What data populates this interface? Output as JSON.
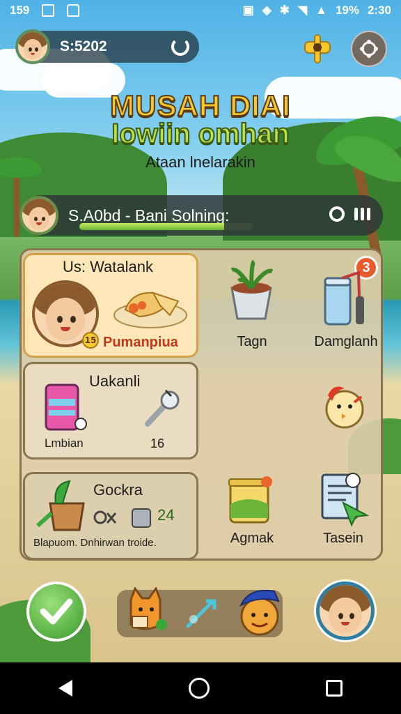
{
  "status_bar": {
    "left_text": "159",
    "battery": "19%",
    "time": "2:30"
  },
  "player": {
    "currency": "S:5202"
  },
  "title": {
    "main": "MUSAH DIAI",
    "sub": "Iowiin omhan",
    "tagline": "Ataan lnelarakin"
  },
  "quest": {
    "text": "S.A0bd - Bani Solning:",
    "progress": 0.83
  },
  "panel": {
    "badge_count": "3",
    "featured": {
      "header": "Us: Watalank",
      "level": "15",
      "food_label": "Pumanpiua"
    },
    "items": [
      {
        "label": "Tagn",
        "icon": "herb-pot-icon"
      },
      {
        "label": "Damglanh",
        "icon": "water-cup-icon"
      },
      {
        "label": "",
        "icon": "chick-icon"
      },
      {
        "label": "Agmak",
        "icon": "honey-jar-icon"
      },
      {
        "label": "Tasein",
        "icon": "book-arrow-icon"
      }
    ],
    "card_b": {
      "title": "Uakanli",
      "left_label": "Lmbian",
      "right_label": "16"
    },
    "card_c": {
      "title": "Gockra",
      "count": "24",
      "footer": "Blapuom. Dnhirwan troide."
    }
  },
  "colors": {
    "accent_gold": "#f7c730",
    "accent_green": "#b8e04a",
    "badge_red": "#e85a2a"
  }
}
